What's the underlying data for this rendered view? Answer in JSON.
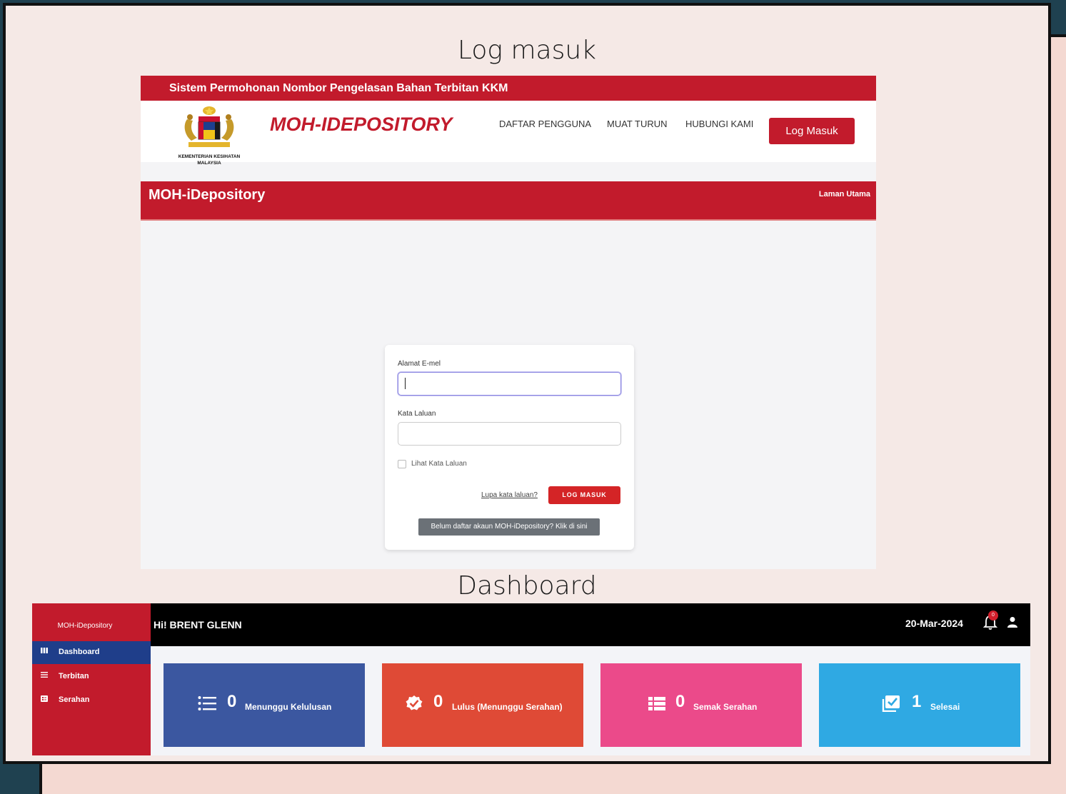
{
  "sections": {
    "login_title": "Log masuk",
    "dashboard_title": "Dashboard"
  },
  "login_page": {
    "topbar_text": "Sistem Permohonan Nombor Pengelasan Bahan Terbitan KKM",
    "crest_caption_1": "KEMENTERIAN KESIHATAN",
    "crest_caption_2": "MALAYSIA",
    "brand": "MOH-IDEPOSITORY",
    "nav": {
      "register": "DAFTAR PENGGUNA",
      "download": "MUAT TURUN",
      "contact": "HUBUNGI KAMI",
      "login_button": "Log Masuk"
    },
    "hero_title": "MOH-iDepository",
    "hero_link": "Laman Utama",
    "form": {
      "email_label": "Alamat E-mel",
      "email_value": "",
      "password_label": "Kata Laluan",
      "password_value": "",
      "show_password_label": "Lihat Kata Laluan",
      "forgot_link": "Lupa kata laluan?",
      "submit_button": "LOG MASUK",
      "register_button": "Belum daftar akaun MOH-iDepository? Klik di sini"
    }
  },
  "dashboard": {
    "sidebar_brand": "MOH-iDepository",
    "sidebar_items": [
      {
        "label": "Dashboard",
        "icon": "columns-icon",
        "active": true
      },
      {
        "label": "Terbitan",
        "icon": "list-icon",
        "active": false
      },
      {
        "label": "Serahan",
        "icon": "tasks-icon",
        "active": false
      }
    ],
    "greeting": "Hi! BRENT GLENN",
    "date": "20-Mar-2024",
    "notification_count": "0",
    "cards": [
      {
        "count": "0",
        "label": "Menunggu Kelulusan",
        "color": "#3b57a0",
        "icon": "list-icon"
      },
      {
        "count": "0",
        "label": "Lulus (Menunggu Serahan)",
        "color": "#df4a36",
        "icon": "check-badge-icon"
      },
      {
        "count": "0",
        "label": "Semak Serahan",
        "color": "#eb4a8a",
        "icon": "table-list-icon"
      },
      {
        "count": "1",
        "label": "Selesai",
        "color": "#2fa9e3",
        "icon": "checked-box-icon"
      }
    ]
  },
  "colors": {
    "primary_red": "#c21b2c",
    "sidebar_active": "#1f3e8a"
  }
}
